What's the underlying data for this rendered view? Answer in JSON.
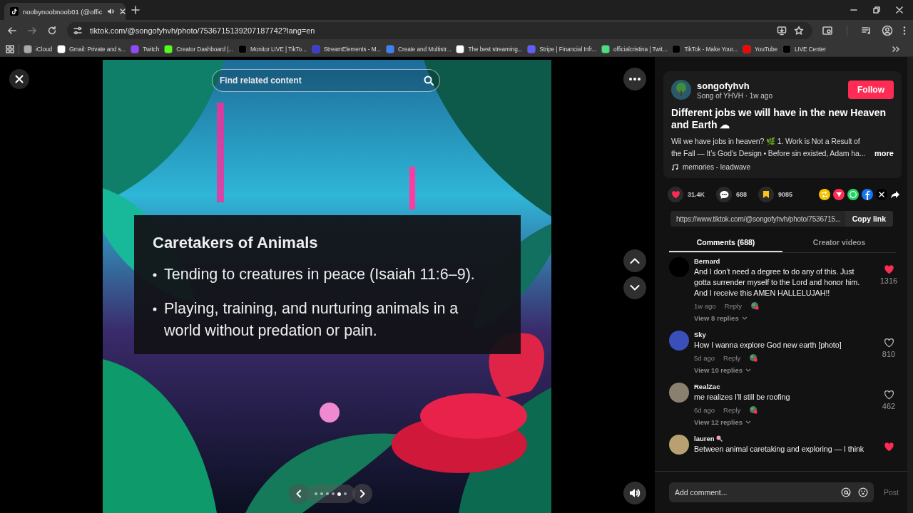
{
  "browser": {
    "tabs": [
      {
        "title": "noobynoobnoob01 (@offic",
        "selected": true
      }
    ],
    "url": "tiktok.com/@songofyhvh/photo/7536715139207187742?lang=en",
    "bookmarks": [
      {
        "label": "iCloud",
        "color": "#aaaaaa"
      },
      {
        "label": "Gmail: Private and s...",
        "color": "#ffffff"
      },
      {
        "label": "Twitch",
        "color": "#9146ff"
      },
      {
        "label": "Creator Dashboard |...",
        "color": "#53fc18"
      },
      {
        "label": "Monitor LIVE | TikTo...",
        "color": "#000000"
      },
      {
        "label": "StreamElements - M...",
        "color": "#3d3cd6"
      },
      {
        "label": "Create and Multistr...",
        "color": "#3b82f6"
      },
      {
        "label": "The best streaming...",
        "color": "#ffffff"
      },
      {
        "label": "Stripe | Financial Infr...",
        "color": "#635bff"
      },
      {
        "label": "officialcristina | Twit...",
        "color": "#4ade80"
      },
      {
        "label": "TikTok - Make Your...",
        "color": "#000000"
      },
      {
        "label": "YouTube",
        "color": "#ff0000"
      },
      {
        "label": "LIVE Center",
        "color": "#000000"
      }
    ]
  },
  "viewer": {
    "search": {
      "placeholder": "Find related content"
    },
    "slide": {
      "title": "Caretakers of Animals",
      "bullets": [
        "Tending to creatures in peace (Isaiah 11:6–9).",
        "Playing, training, and nurturing animals in a world without predation or pain."
      ]
    },
    "dots": [
      {
        "selected": false
      },
      {
        "selected": false
      },
      {
        "selected": false
      },
      {
        "selected": false
      },
      {
        "selected": true
      },
      {
        "selected": false
      }
    ]
  },
  "post": {
    "author": "songofyhvh",
    "byline": "Song of YHVH · 1w ago",
    "follow": "Follow",
    "title": "Different jobs we will have in the new Heaven and Earth ☁",
    "description": "Wil we have jobs in heaven? 🌿 1. Work is Not a Result of the Fall — It’s God’s Design • Before sin existed, Adam ha...",
    "more": "more",
    "music": "memories - leadwave",
    "likes": "31.4K",
    "liked": true,
    "comments": "688",
    "saves": "9085",
    "link": "https://www.tiktok.com/@songofyhvh/photo/7536715...",
    "copy": "Copy link"
  },
  "panel_tabs": [
    {
      "label": "Comments (688)",
      "selected": true
    },
    {
      "label": "Creator videos",
      "selected": false
    }
  ],
  "comments": [
    {
      "user": "Bernard",
      "text": "And I don’t need a degree to do any of this. Just gotta surrender myself to the Lord and honor him. And I receive this AMEN HALLELUJAH!!",
      "time": "1w ago",
      "reply": "Reply",
      "replies": "View 8 replies",
      "likes": "1316",
      "liked": true,
      "color": "#000000"
    },
    {
      "user": "Sky",
      "text": "How I wanna explore God new earth [photo]",
      "time": "5d ago",
      "reply": "Reply",
      "replies": "View 10 replies",
      "likes": "810",
      "liked": false,
      "color": "#3a4fb8"
    },
    {
      "user": "RealZac",
      "text": "me realizes I'll still be roofing",
      "time": "6d ago",
      "reply": "Reply",
      "replies": "View 12 replies",
      "likes": "462",
      "liked": false,
      "color": "#8a8070"
    },
    {
      "user": "lauren",
      "text": "Between animal caretaking and exploring — I think",
      "liked": true,
      "color": "#b8a070"
    }
  ],
  "composer": {
    "placeholder": "Add comment...",
    "post": "Post"
  }
}
